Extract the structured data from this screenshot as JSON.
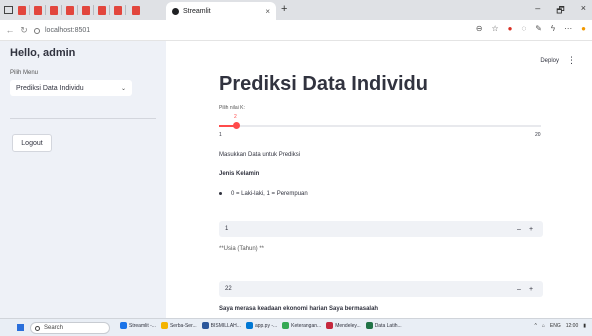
{
  "browser": {
    "active_tab_title": "Streamlit",
    "tab_close": "×",
    "new_tab": "+",
    "url": "localhost:8501",
    "pinned_tab_count": 8,
    "window_controls": [
      "–",
      "🗗",
      "×"
    ]
  },
  "sidebar": {
    "greeting": "Hello, admin",
    "menu_label": "Pilih Menu",
    "menu_selected": "Prediksi Data Individu",
    "logout_label": "Logout"
  },
  "header": {
    "deploy_label": "Deploy",
    "menu_icon": "⋮"
  },
  "main": {
    "title": "Prediksi Data Individu",
    "slider": {
      "label": "Pilih nilai K:",
      "value": "2",
      "min_label": "1",
      "max_label": "20",
      "min": 1,
      "max": 20,
      "current": 2
    },
    "section_heading": "Masukkan Data untuk Prediksi",
    "gender_title": "Jenis Kelamin",
    "gender_hint": "0 = Laki-laki, 1 = Perempuan",
    "gender_input_value": "1",
    "usia_label": "**Usia (Tahun) **",
    "usia_input_value": "22",
    "ekonomi_label": "Saya merasa keadaan ekonomi harian Saya bermasalah",
    "stepper_minus": "–",
    "stepper_plus": "+"
  },
  "taskbar": {
    "search_placeholder": "Search",
    "apps": [
      "Streamlit -...",
      "Serba-Ser...",
      "BISMILLAH...",
      "app.py -...",
      "Keterangan...",
      "Mendeley...",
      "Data Latih..."
    ],
    "tray_lang": "ENG",
    "tray_time": "12:00"
  },
  "colors": {
    "accent": "#ff4b4b",
    "sidebar_bg": "#eef1f7",
    "input_bg": "#f0f2f6",
    "text": "#31333f"
  }
}
